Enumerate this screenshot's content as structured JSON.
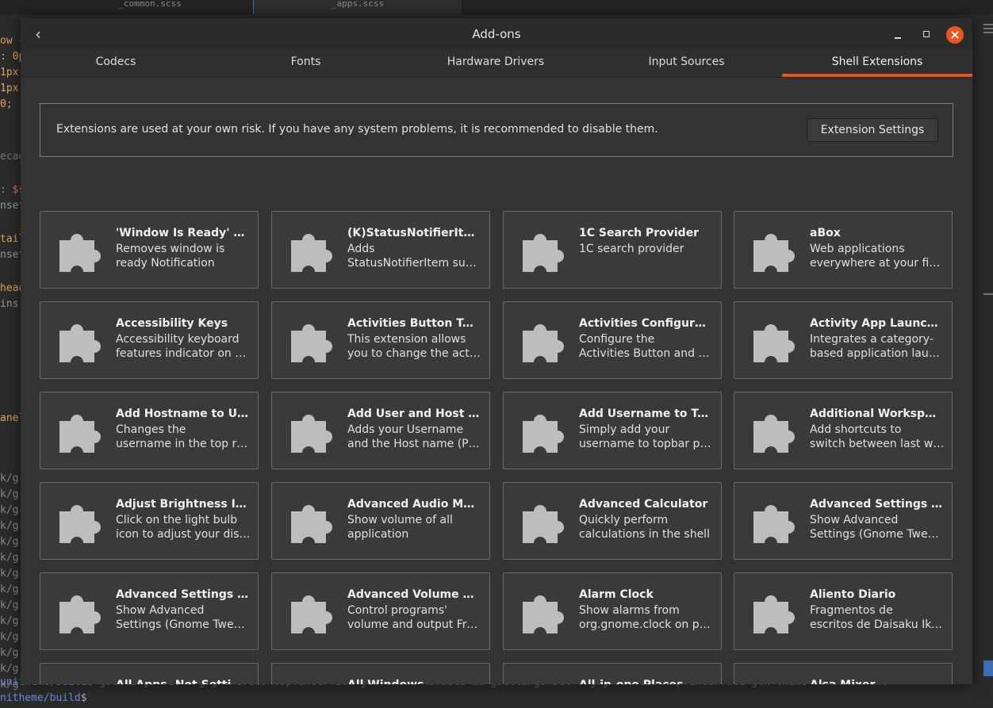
{
  "editor": {
    "tabs": [
      "_common.scss",
      "_apps.scss"
    ],
    "code_lines": [
      {
        "text": "ow {",
        "color": "#e1a35b"
      },
      {
        "text": ": 0p",
        "color": "#e1a35b"
      },
      {
        "text": "1px",
        "color": "#e1a35b"
      },
      {
        "text": " 1px",
        "color": "#e1a35b"
      },
      {
        "text": "0;",
        "color": "#e1a35b"
      },
      {
        "text": "ecad",
        "color": "#777777"
      },
      {
        "text": ": $s",
        "color": "#e96b6b"
      },
      {
        "text": "nset",
        "color": "#9a9a9a"
      },
      {
        "text": "tail",
        "color": "#e1a35b"
      },
      {
        "text": "nset",
        "color": "#9a9a9a"
      },
      {
        "text": "head",
        "color": "#e1a35b"
      },
      {
        "text": " ins",
        "color": "#9a9a9a"
      },
      {
        "text": "anel",
        "color": "#e1a35b"
      },
      {
        "text": "k/g",
        "color": "#8a8a8a"
      },
      {
        "text": "k/g",
        "color": "#8a8a8a"
      },
      {
        "text": "k/g",
        "color": "#8a8a8a"
      },
      {
        "text": "k/g",
        "color": "#8a8a8a"
      },
      {
        "text": "k/g",
        "color": "#8a8a8a"
      },
      {
        "text": "k/g",
        "color": "#8a8a8a"
      },
      {
        "text": "k/g",
        "color": "#8a8a8a"
      },
      {
        "text": "k/g",
        "color": "#8a8a8a"
      },
      {
        "text": "k/g",
        "color": "#8a8a8a"
      },
      {
        "text": "k/g",
        "color": "#8a8a8a"
      },
      {
        "text": "k/g",
        "color": "#8a8a8a"
      },
      {
        "text": "k/g",
        "color": "#8a8a8a"
      },
      {
        "text": "k/g",
        "color": "#8a8a8a"
      },
      {
        "text": "k/g",
        "color": "#8a8a8a"
      }
    ],
    "terminal_line1_prefix": "unitheme/build",
    "terminal_line1": "$ gsettings set org.gnome.desktop.interface gtk-theme Adwaita && gsettings set org.gnome.desktop.interface gtk-theme communitheme",
    "terminal_line2_prefix": "nitheme/build",
    "terminal_line2": "$"
  },
  "dialog": {
    "title": "Add-ons",
    "back_icon": "chevron-left-icon",
    "tabs": [
      {
        "label": "Codecs",
        "active": false
      },
      {
        "label": "Fonts",
        "active": false
      },
      {
        "label": "Hardware Drivers",
        "active": false
      },
      {
        "label": "Input Sources",
        "active": false
      },
      {
        "label": "Shell Extensions",
        "active": true
      }
    ],
    "accent": "#e95420",
    "notice": {
      "text": "Extensions are used at your own risk. If you have any system problems, it is recommended to disable them.",
      "button_label": "Extension Settings"
    },
    "extensions": [
      {
        "name": "'Window Is Ready' Notification Remover",
        "desc": [
          "Removes window is",
          "ready Notification"
        ]
      },
      {
        "name": "(K)StatusNotifierItem/AppIndicator Support",
        "desc": [
          "Adds",
          "StatusNotifierItem support"
        ]
      },
      {
        "name": "1C Search Provider",
        "desc": [
          "1C search provider"
        ]
      },
      {
        "name": "aBox",
        "desc": [
          "Web applications",
          "everywhere at your fingertips"
        ]
      },
      {
        "name": "Accessibility Keys",
        "desc": [
          "Accessibility keyboard",
          "features indicator on panel"
        ]
      },
      {
        "name": "Activities Button Text",
        "desc": [
          "This extension allows",
          "you to change the activities text"
        ]
      },
      {
        "name": "Activities Configurator",
        "desc": [
          "Configure the",
          "Activities Button and Top Panel"
        ]
      },
      {
        "name": "Activity App Launcher",
        "desc": [
          "Integrates a category-",
          "based application launcher"
        ]
      },
      {
        "name": "Add Hostname to User Menu",
        "desc": [
          "Changes the",
          "username in the top right"
        ]
      },
      {
        "name": "Add User and Host name to Panel",
        "desc": [
          "Adds your Username",
          "and the Host name (PC name)"
        ]
      },
      {
        "name": "Add Username to Top Panel",
        "desc": [
          "Simply add your",
          "username to topbar panel"
        ]
      },
      {
        "name": "Additional Workspace Shortcuts",
        "desc": [
          "Add shortcuts to",
          "switch between last workspaces"
        ]
      },
      {
        "name": "Adjust Brightness Icon",
        "desc": [
          "Click on the light bulb",
          "icon to adjust your display"
        ]
      },
      {
        "name": "Advanced Audio Menu",
        "desc": [
          "Show volume of all",
          "application"
        ]
      },
      {
        "name": "Advanced Calculator",
        "desc": [
          "Quickly perform",
          "calculations in the shell"
        ]
      },
      {
        "name": "Advanced Settings in UserMenu",
        "desc": [
          "Show Advanced",
          "Settings (Gnome Tweak Tool)"
        ]
      },
      {
        "name": "Advanced Settings in Menu",
        "desc": [
          "Show Advanced",
          "Settings (Gnome Tweak Tool)"
        ]
      },
      {
        "name": "Advanced Volume Mixer",
        "desc": [
          "Control programs'",
          "volume and output From panel"
        ]
      },
      {
        "name": "Alarm Clock",
        "desc": [
          "Show alarms from",
          "org.gnome.clock on panel"
        ]
      },
      {
        "name": "Aliento Diario",
        "desc": [
          "Fragmentos de",
          "escritos de Daisaku Ikeda"
        ]
      },
      {
        "name": "All Apps, Not Settings",
        "desc": []
      },
      {
        "name": "All Windows",
        "desc": []
      },
      {
        "name": "All-in-one Places",
        "desc": []
      },
      {
        "name": "Alsa Mixer",
        "desc": []
      }
    ]
  }
}
